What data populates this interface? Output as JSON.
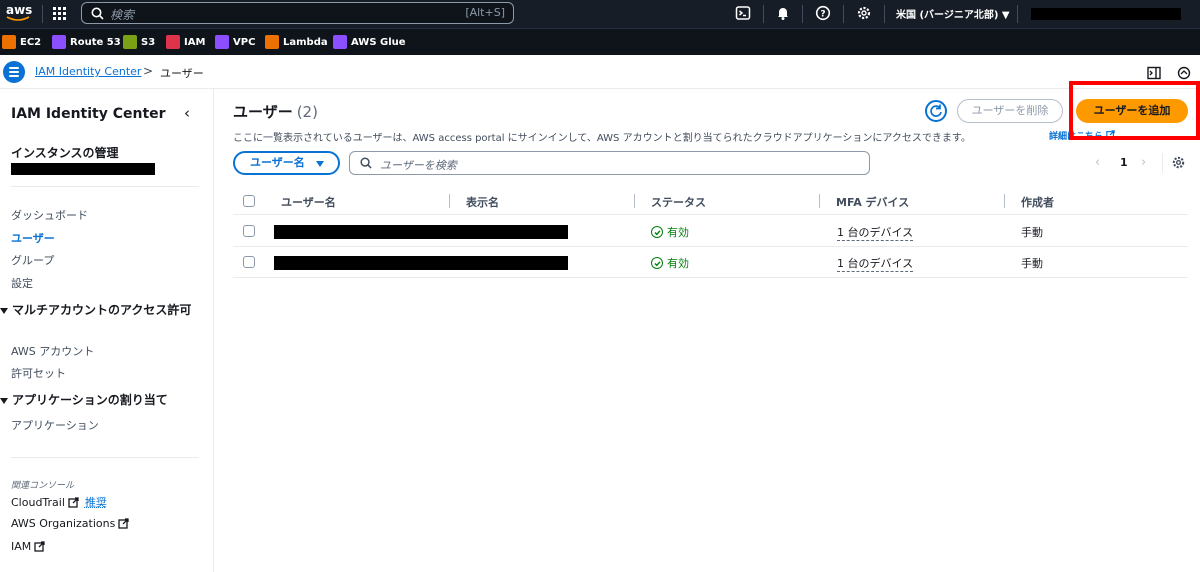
{
  "topbar": {
    "logo_text": "aws",
    "search_placeholder": "検索",
    "search_shortcut": "[Alt+S]",
    "region": "米国 (バージニア北部) ▼"
  },
  "favorites": [
    {
      "label": "EC2",
      "color": "#ed7100"
    },
    {
      "label": "Route 53",
      "color": "#8c4fff"
    },
    {
      "label": "S3",
      "color": "#7aa116"
    },
    {
      "label": "IAM",
      "color": "#dd344c"
    },
    {
      "label": "VPC",
      "color": "#8c4fff"
    },
    {
      "label": "Lambda",
      "color": "#ed7100"
    },
    {
      "label": "AWS Glue",
      "color": "#8c4fff"
    }
  ],
  "breadcrumb": {
    "link": "IAM Identity Center",
    "separator": ">",
    "current": "ユーザー"
  },
  "sidebar": {
    "title": "IAM Identity Center",
    "section": "インスタンスの管理",
    "items": [
      "ダッシュボード",
      "ユーザー",
      "グループ",
      "設定"
    ],
    "group1": {
      "title": "マルチアカウントのアクセス許可",
      "items": [
        "AWS アカウント",
        "許可セット"
      ]
    },
    "group2": {
      "title": "アプリケーションの割り当て",
      "items": [
        "アプリケーション"
      ]
    },
    "related_title": "関連コンソール",
    "related": [
      {
        "label": "CloudTrail",
        "extra": "推奨"
      },
      {
        "label": "AWS Organizations"
      },
      {
        "label": "IAM"
      }
    ]
  },
  "main": {
    "title": "ユーザー",
    "count": "(2)",
    "description": "ここに一覧表示されているユーザーは、AWS access portal にサインインして、AWS アカウントと割り当てられたクラウドアプリケーションにアクセスできます。",
    "description_link": "詳細はこちら",
    "delete_label": "ユーザーを削除",
    "add_label": "ユーザーを追加",
    "filter_property": "ユーザー名",
    "filter_placeholder": "ユーザーを検索",
    "page": "1",
    "columns": [
      "ユーザー名",
      "表示名",
      "ステータス",
      "MFA デバイス",
      "作成者"
    ],
    "rows": [
      {
        "status": "有効",
        "mfa": "1 台のデバイス",
        "creator": "手動"
      },
      {
        "status": "有効",
        "mfa": "1 台のデバイス",
        "creator": "手動"
      }
    ]
  }
}
